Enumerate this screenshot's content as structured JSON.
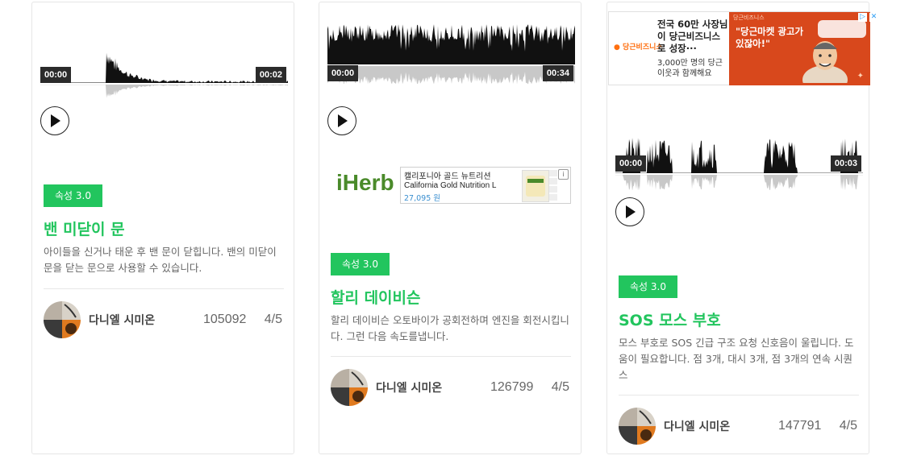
{
  "cards": [
    {
      "start": "00:00",
      "end": "00:02",
      "badge": "속성 3.0",
      "title": "밴 미닫이 문",
      "desc": "아이들을 신거나 태운 후 밴 문이 닫힙니다. 밴의 미닫이 문을 닫는 문으로 사용할 수 있습니다.",
      "author": "다니엘 시미온",
      "downloads": "105092",
      "rating": "4/5"
    },
    {
      "start": "00:00",
      "end": "00:34",
      "badge": "속성 3.0",
      "title": "할리 데이비슨",
      "desc": "할리 데이비슨 오토바이가 공회전하며 엔진을 회전시킵니다. 그런 다음 속도를냅니다.",
      "author": "다니엘 시미온",
      "downloads": "126799",
      "rating": "4/5"
    },
    {
      "start": "00:00",
      "end": "00:03",
      "badge": "속성 3.0",
      "title": "SOS 모스 부호",
      "desc": "모스 부호로 SOS 긴급 구조 요청 신호음이 울립니다. 도움이 필요합니다. 점 3개, 대시 3개, 점 3개의 연속 시퀀스",
      "author": "다니엘 시미온",
      "downloads": "147791",
      "rating": "4/5"
    }
  ],
  "iherb_ad": {
    "logo": "iHerb",
    "kr": "캘리포니아 골드 뉴트리션",
    "en": "California Gold Nutrition L",
    "price": "27,095 원"
  },
  "daangn_ad": {
    "brand": "당근비즈니스",
    "headline": "전국 60만 사장님이 당근비즈니스로 성장···",
    "sub": "3,000만 명의 당근 이웃과 함께해요",
    "quote": "\"당근마켓 광고가 있잖아!\""
  }
}
